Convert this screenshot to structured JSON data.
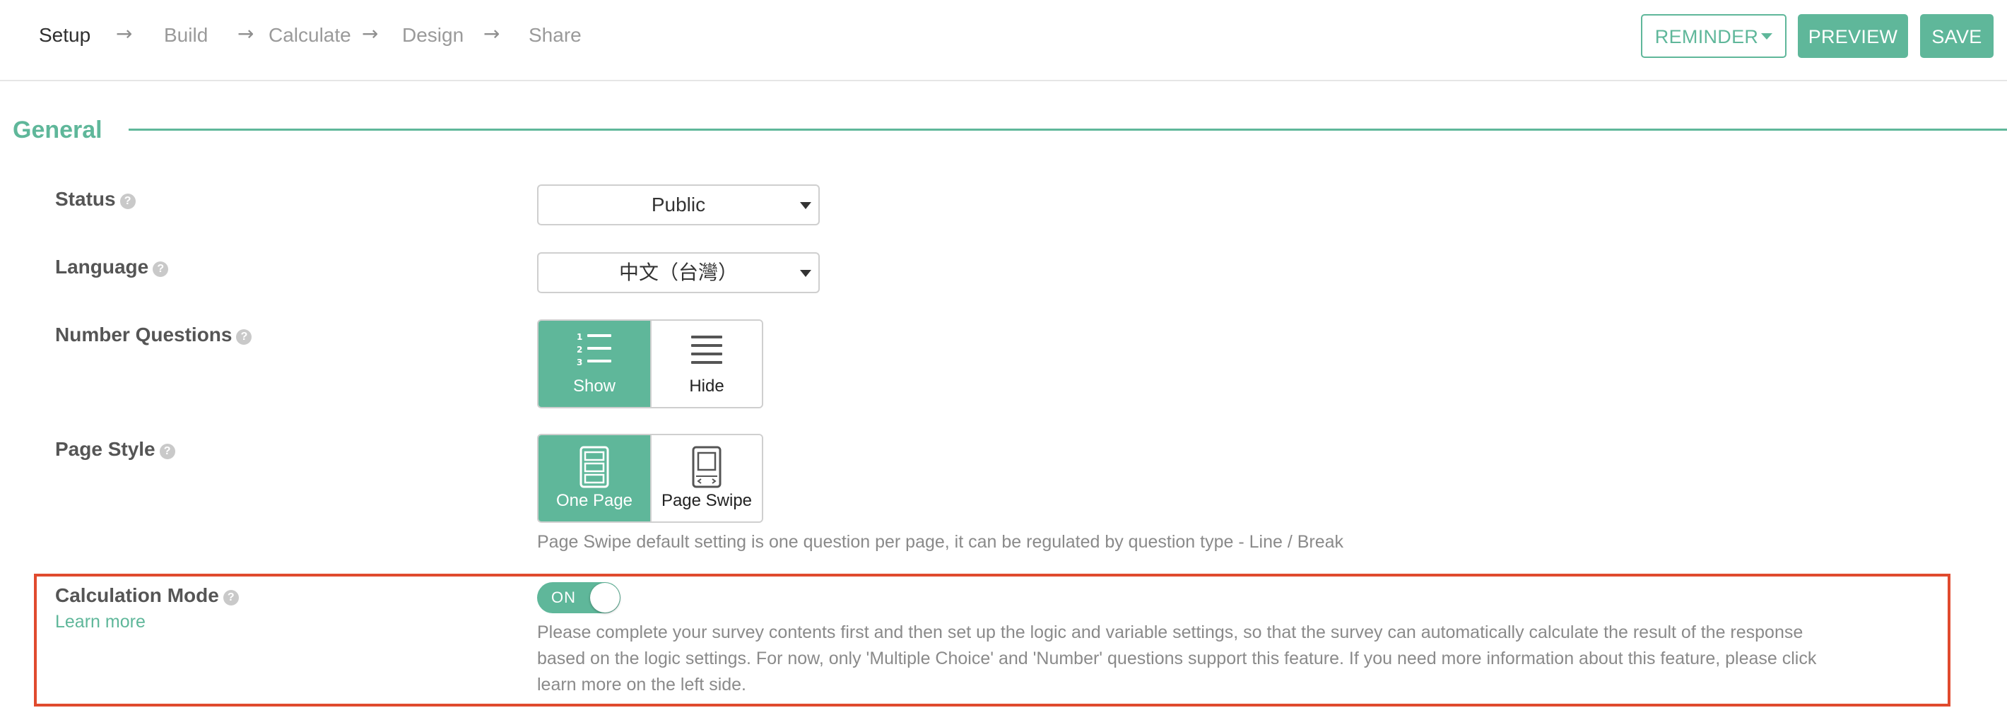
{
  "steps": {
    "setup": "Setup",
    "build": "Build",
    "calculate": "Calculate",
    "design": "Design",
    "share": "Share",
    "arrow": "→"
  },
  "toolbar": {
    "reminder_label": "REMINDER",
    "preview_label": "PREVIEW",
    "save_label": "SAVE"
  },
  "section": {
    "title": "General"
  },
  "status": {
    "label": "Status",
    "value": "Public"
  },
  "language": {
    "label": "Language",
    "value": "中文（台灣）"
  },
  "number_questions": {
    "label": "Number Questions",
    "options": [
      {
        "label": "Show",
        "icon": "numbered-list-icon",
        "selected": true
      },
      {
        "label": "Hide",
        "icon": "list-icon",
        "selected": false
      }
    ]
  },
  "page_style": {
    "label": "Page Style",
    "options": [
      {
        "label": "One Page",
        "icon": "one-page-icon",
        "selected": true
      },
      {
        "label": "Page Swipe",
        "icon": "page-swipe-icon",
        "selected": false
      }
    ],
    "hint": "Page Swipe default setting is one question per page, it can be regulated by question type - Line / Break"
  },
  "calculation_mode": {
    "label": "Calculation Mode",
    "learn_more": "Learn more",
    "toggle_text": "ON",
    "hint_line1": "Please complete your survey contents first and then set up the logic and variable settings, so that the survey can automatically calculate the result of the response",
    "hint_line2": "based on the logic settings. For now, only 'Multiple Choice' and 'Number' questions support this feature. If you need more information about this feature, please click",
    "hint_line3": "learn more on the left side."
  },
  "help_glyph": "?",
  "colors": {
    "accent": "#5fb79a",
    "highlight_border": "#e04a2e",
    "muted_text": "#8a8a8a"
  }
}
